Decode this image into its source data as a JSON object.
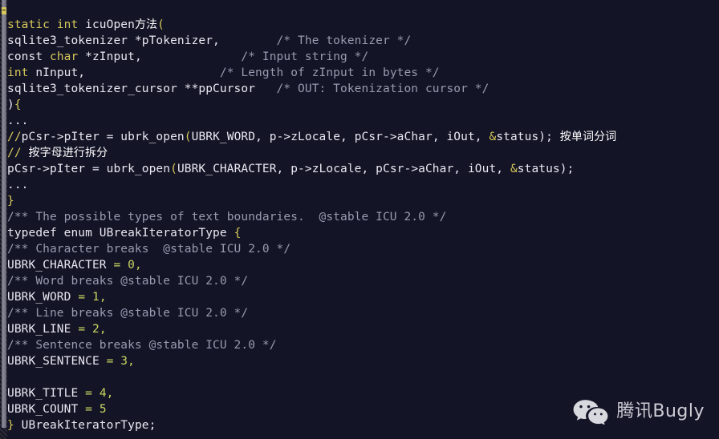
{
  "theme": {
    "background": "#141427",
    "keyword_color": "#d6c85a",
    "identifier_color": "#e9e9f2",
    "comment_color": "#9a9ab0",
    "number_color": "#c9d661",
    "gutter_color": "#9b9ba8"
  },
  "watermark": {
    "icon": "wechat-logo-icon",
    "label": "腾讯Bugly"
  },
  "code": {
    "language": "c",
    "lines": [
      {
        "n": 1,
        "tokens": [
          {
            "t": "static int ",
            "c": "kw"
          },
          {
            "t": "icuOpen",
            "c": "id"
          },
          {
            "t": "方法",
            "c": "cn"
          },
          {
            "t": "(",
            "c": "kw"
          }
        ]
      },
      {
        "n": 2,
        "tokens": [
          {
            "t": "sqlite3_tokenizer *pTokenizer,",
            "c": "id"
          },
          {
            "t": "        ",
            "c": "id"
          },
          {
            "t": "/* The tokenizer */",
            "c": "cmt"
          }
        ]
      },
      {
        "n": 3,
        "tokens": [
          {
            "t": "const ",
            "c": "id"
          },
          {
            "t": "char ",
            "c": "kw"
          },
          {
            "t": "*zInput,",
            "c": "id"
          },
          {
            "t": "              ",
            "c": "id"
          },
          {
            "t": "/* Input string */",
            "c": "cmt"
          }
        ]
      },
      {
        "n": 4,
        "tokens": [
          {
            "t": "int ",
            "c": "kw"
          },
          {
            "t": "nInput,",
            "c": "id"
          },
          {
            "t": "                   ",
            "c": "id"
          },
          {
            "t": "/* Length of zInput in bytes */",
            "c": "cmt"
          }
        ]
      },
      {
        "n": 5,
        "tokens": [
          {
            "t": "sqlite3_tokenizer_cursor **ppCursor",
            "c": "id"
          },
          {
            "t": "   ",
            "c": "id"
          },
          {
            "t": "/* OUT: Tokenization cursor */",
            "c": "cmt"
          }
        ]
      },
      {
        "n": 6,
        "tokens": [
          {
            "t": ")",
            "c": "id"
          },
          {
            "t": "{",
            "c": "kw"
          }
        ]
      },
      {
        "n": 7,
        "tokens": [
          {
            "t": "...",
            "c": "id"
          }
        ]
      },
      {
        "n": 8,
        "tokens": [
          {
            "t": "//",
            "c": "kw"
          },
          {
            "t": "pCsr->pIter = ubrk_open",
            "c": "id"
          },
          {
            "t": "(",
            "c": "kw"
          },
          {
            "t": "UBRK_WORD, p->zLocale, pCsr->aChar, iOut, ",
            "c": "id"
          },
          {
            "t": "&",
            "c": "kw"
          },
          {
            "t": "status); ",
            "c": "id"
          },
          {
            "t": "按单词分词",
            "c": "cn"
          }
        ]
      },
      {
        "n": 9,
        "tokens": [
          {
            "t": "//",
            "c": "kw"
          },
          {
            "t": " ",
            "c": "id"
          },
          {
            "t": "按字母进行拆分",
            "c": "cn"
          }
        ]
      },
      {
        "n": 10,
        "tokens": [
          {
            "t": "pCsr->pIter = ubrk_open",
            "c": "id"
          },
          {
            "t": "(",
            "c": "kw"
          },
          {
            "t": "UBRK_CHARACTER, p->zLocale, pCsr->aChar, iOut, ",
            "c": "id"
          },
          {
            "t": "&",
            "c": "kw"
          },
          {
            "t": "status);",
            "c": "id"
          }
        ]
      },
      {
        "n": 11,
        "tokens": [
          {
            "t": "...",
            "c": "id"
          }
        ]
      },
      {
        "n": 12,
        "tokens": [
          {
            "t": "}",
            "c": "kw"
          }
        ]
      },
      {
        "n": 13,
        "tokens": [
          {
            "t": "/** The possible types of text boundaries.  @stable ICU 2.0 */",
            "c": "cmt"
          }
        ]
      },
      {
        "n": 14,
        "tokens": [
          {
            "t": "typedef enum UBreakIteratorType ",
            "c": "id"
          },
          {
            "t": "{",
            "c": "kw"
          }
        ]
      },
      {
        "n": 15,
        "tokens": [
          {
            "t": "/** Character breaks  @stable ICU 2.0 */",
            "c": "cmt"
          }
        ]
      },
      {
        "n": 16,
        "tokens": [
          {
            "t": "UBRK_CHARACTER ",
            "c": "id"
          },
          {
            "t": "= ",
            "c": "num"
          },
          {
            "t": "0",
            "c": "num"
          },
          {
            "t": ",",
            "c": "num"
          }
        ]
      },
      {
        "n": 17,
        "tokens": [
          {
            "t": "/** Word breaks @stable ICU 2.0 */",
            "c": "cmt"
          }
        ]
      },
      {
        "n": 18,
        "tokens": [
          {
            "t": "UBRK_WORD ",
            "c": "id"
          },
          {
            "t": "= ",
            "c": "num"
          },
          {
            "t": "1",
            "c": "num"
          },
          {
            "t": ",",
            "c": "num"
          }
        ]
      },
      {
        "n": 19,
        "tokens": [
          {
            "t": "/** Line breaks @stable ICU 2.0 */",
            "c": "cmt"
          }
        ]
      },
      {
        "n": 20,
        "tokens": [
          {
            "t": "UBRK_LINE ",
            "c": "id"
          },
          {
            "t": "= ",
            "c": "num"
          },
          {
            "t": "2",
            "c": "num"
          },
          {
            "t": ",",
            "c": "num"
          }
        ]
      },
      {
        "n": 21,
        "tokens": [
          {
            "t": "/** Sentence breaks @stable ICU 2.0 */",
            "c": "cmt"
          }
        ]
      },
      {
        "n": 22,
        "tokens": [
          {
            "t": "UBRK_SENTENCE ",
            "c": "id"
          },
          {
            "t": "= ",
            "c": "num"
          },
          {
            "t": "3",
            "c": "num"
          },
          {
            "t": ",",
            "c": "num"
          }
        ]
      },
      {
        "n": 23,
        "tokens": []
      },
      {
        "n": 24,
        "tokens": [
          {
            "t": "UBRK_TITLE ",
            "c": "id"
          },
          {
            "t": "= ",
            "c": "num"
          },
          {
            "t": "4",
            "c": "num"
          },
          {
            "t": ",",
            "c": "num"
          }
        ]
      },
      {
        "n": 25,
        "tokens": [
          {
            "t": "UBRK_COUNT ",
            "c": "id"
          },
          {
            "t": "= ",
            "c": "num"
          },
          {
            "t": "5",
            "c": "num"
          }
        ]
      },
      {
        "n": 26,
        "tokens": [
          {
            "t": "}",
            "c": "kw"
          },
          {
            "t": " UBreakIteratorType;",
            "c": "id"
          }
        ]
      }
    ]
  }
}
